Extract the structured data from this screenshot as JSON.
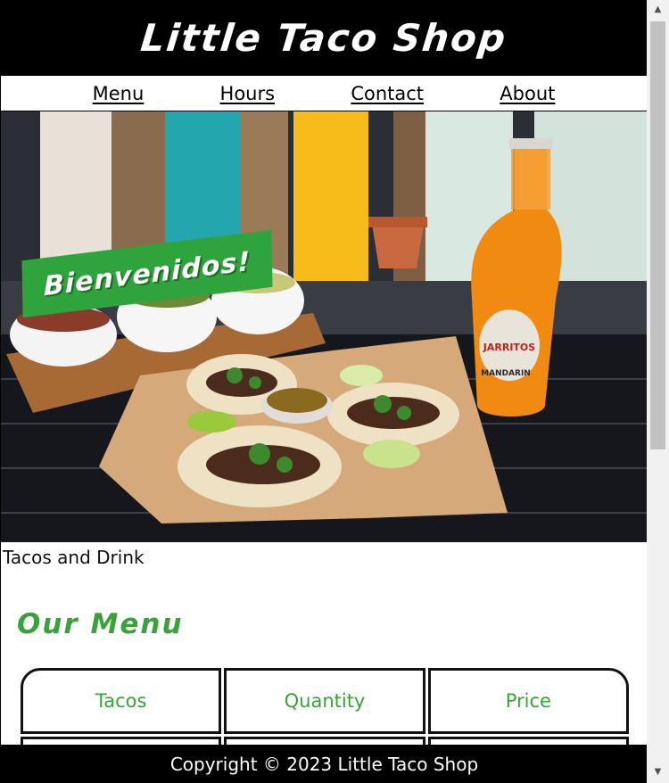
{
  "header": {
    "title": "Little Taco Shop"
  },
  "nav": {
    "items": [
      "Menu",
      "Hours",
      "Contact",
      "About"
    ]
  },
  "hero": {
    "banner_text": "Bienvenidos!",
    "bottle_label": "JARRITOS",
    "bottle_flavor": "MANDARIN",
    "caption": "Tacos and Drink"
  },
  "menu": {
    "heading": "Our Menu",
    "columns": [
      "Tacos",
      "Quantity",
      "Price"
    ]
  },
  "footer": {
    "copyright": "Copyright © 2023 Little Taco Shop"
  },
  "colors": {
    "accent_green": "#3aa23a",
    "banner_green": "#2fa43c",
    "header_bg": "#000000"
  }
}
